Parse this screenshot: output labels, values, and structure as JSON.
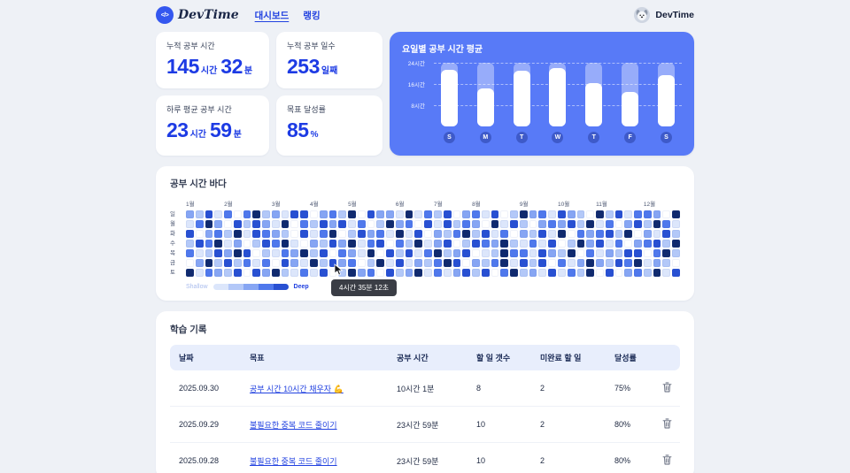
{
  "theme": {
    "primary": "#2141e0",
    "chart_bg": "#587af7"
  },
  "header": {
    "brand": "DevTime",
    "logo_glyph": "</>",
    "nav": [
      {
        "name": "dashboard",
        "label": "대시보드",
        "active": true
      },
      {
        "name": "ranking",
        "label": "랭킹",
        "active": false
      }
    ],
    "user_name": "DevTime"
  },
  "stats": [
    {
      "name": "total-study-time",
      "label": "누적 공부 시간",
      "parts": [
        {
          "v": "145",
          "u": "시간"
        },
        {
          "v": "32",
          "u": "분"
        }
      ]
    },
    {
      "name": "total-study-days",
      "label": "누적 공부 일수",
      "parts": [
        {
          "v": "253",
          "u": "일째"
        }
      ]
    },
    {
      "name": "daily-average-time",
      "label": "하루 평균 공부 시간",
      "parts": [
        {
          "v": "23",
          "u": "시간"
        },
        {
          "v": "59",
          "u": "분"
        }
      ]
    },
    {
      "name": "goal-achievement-rate",
      "label": "목표 달성률",
      "parts": [
        {
          "v": "85",
          "u": "%"
        }
      ]
    }
  ],
  "chart_data": {
    "type": "bar",
    "title": "요일별 공부 시간 평균",
    "categories": [
      "S",
      "M",
      "T",
      "W",
      "T",
      "F",
      "S"
    ],
    "values": [
      21.5,
      14.5,
      21,
      22,
      16.5,
      13,
      19.5
    ],
    "unit": "시간",
    "ylim": [
      0,
      24
    ],
    "yticks": [
      {
        "label": "24시간",
        "value": 24
      },
      {
        "label": "16시간",
        "value": 16
      },
      {
        "label": "8시간",
        "value": 8
      }
    ],
    "grid": "dashed-horizontal",
    "legend": "none"
  },
  "heatmap": {
    "title": "공부 시간 바다",
    "months": [
      "1월",
      "2월",
      "3월",
      "4월",
      "5월",
      "6월",
      "7월",
      "8월",
      "9월",
      "10월",
      "11월",
      "12월"
    ],
    "days": [
      "일",
      "월",
      "화",
      "수",
      "목",
      "금",
      "토"
    ],
    "legend_low": "Shallow",
    "legend_high": "Deep",
    "tooltip": "4시간 35분 12초",
    "palette": [
      "#ffffff",
      "#dce6fb",
      "#b3c8f8",
      "#86a5f3",
      "#4f78ec",
      "#2850d2",
      "#102a6e"
    ],
    "rows": [
      "3251404623155034260533161425034150263415320625144306",
      "1463052531604253514026340515243061520343526140352641",
      "5034261543205146025341615032462514032516043452603152",
      "2546130254610325361450426135025436214150263514034526",
      "4125365021436250431605251462350126441532604132550462",
      "0362524140531625340261513246503246152504136325461320",
      "6143250536214150263405236141352504623151426050342615"
    ]
  },
  "records": {
    "title": "학습 기록",
    "columns": [
      "날짜",
      "목표",
      "공부 시간",
      "할 일 갯수",
      "미완료 할 일",
      "달성률"
    ],
    "rows": [
      {
        "date": "2025.09.30",
        "goal": "공부 시간 10시간 채우자 💪",
        "time": "10시간 1분",
        "todos": "8",
        "incomplete": "2",
        "rate": "75%"
      },
      {
        "date": "2025.09.29",
        "goal": "불필요한 중복 코드 줄이기",
        "time": "23시간 59분",
        "todos": "10",
        "incomplete": "2",
        "rate": "80%"
      },
      {
        "date": "2025.09.28",
        "goal": "불필요한 중복 코드 줄이기",
        "time": "23시간 59분",
        "todos": "10",
        "incomplete": "2",
        "rate": "80%"
      }
    ]
  }
}
